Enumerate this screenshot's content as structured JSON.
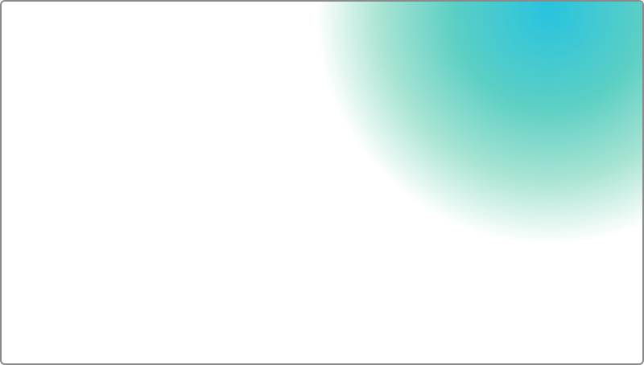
{
  "canvas": {
    "background_color": "#ffffff",
    "border_color": "#8a8a8a"
  },
  "decoration": {
    "type": "radial-glow",
    "corner": "top-right",
    "colors": {
      "core": "#28c3df",
      "mid": "#5ccfc4",
      "outer": "#a9e4d3"
    }
  }
}
